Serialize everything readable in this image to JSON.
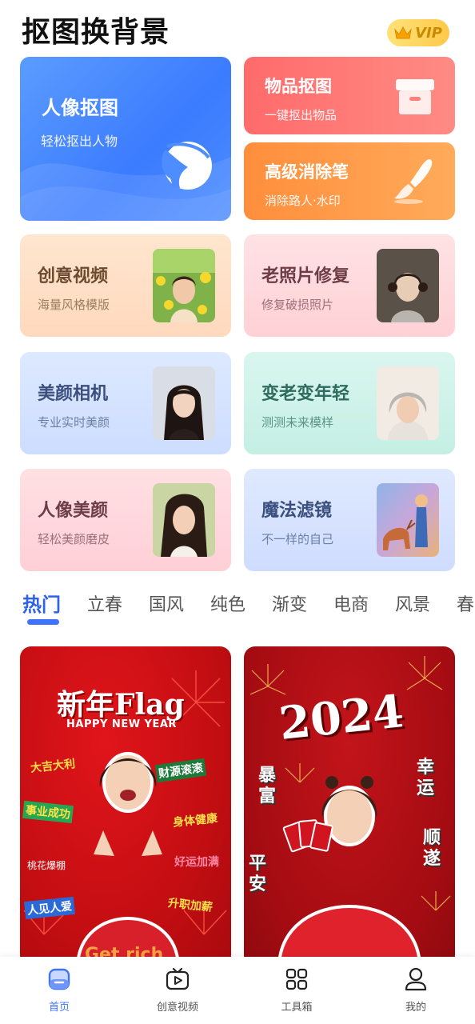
{
  "header": {
    "title": "抠图换背景",
    "vip_label": "VIP"
  },
  "features": {
    "portrait_cutout": {
      "title": "人像抠图",
      "subtitle": "轻松抠出人物"
    },
    "item_cutout": {
      "title": "物品抠图",
      "subtitle": "一键抠出物品"
    },
    "eraser": {
      "title": "高级消除笔",
      "subtitle": "消除路人·水印"
    }
  },
  "tools": [
    {
      "title": "创意视频",
      "subtitle": "海量风格模版"
    },
    {
      "title": "老照片修复",
      "subtitle": "修复破损照片"
    },
    {
      "title": "美颜相机",
      "subtitle": "专业实时美颜"
    },
    {
      "title": "变老变年轻",
      "subtitle": "测测未来模样"
    },
    {
      "title": "人像美颜",
      "subtitle": "轻松美颜磨皮"
    },
    {
      "title": "魔法滤镜",
      "subtitle": "不一样的自己"
    }
  ],
  "tabs": [
    "热门",
    "立春",
    "国风",
    "纯色",
    "渐变",
    "电商",
    "风景",
    "春"
  ],
  "active_tab": "热门",
  "templates": {
    "t1": {
      "title": "新年Flag",
      "subtitle": "HAPPY NEW YEAR",
      "stickers": [
        "大吉大利",
        "财源滚滚",
        "事业成功",
        "身体健康",
        "桃花爆棚",
        "好运加满",
        "人见人爱",
        "升职加薪",
        "Get rich"
      ]
    },
    "t2": {
      "year": "2024",
      "words": [
        "暴富",
        "幸运",
        "顺遂",
        "平安"
      ]
    }
  },
  "bottom_nav": [
    {
      "label": "首页",
      "icon": "home-icon",
      "active": true
    },
    {
      "label": "创意视频",
      "icon": "video-icon",
      "active": false
    },
    {
      "label": "工具箱",
      "icon": "toolbox-icon",
      "active": false
    },
    {
      "label": "我的",
      "icon": "profile-icon",
      "active": false
    }
  ],
  "colors": {
    "accent": "#3f73ff",
    "red": "#c40e12",
    "vip": "#ffc94a"
  }
}
